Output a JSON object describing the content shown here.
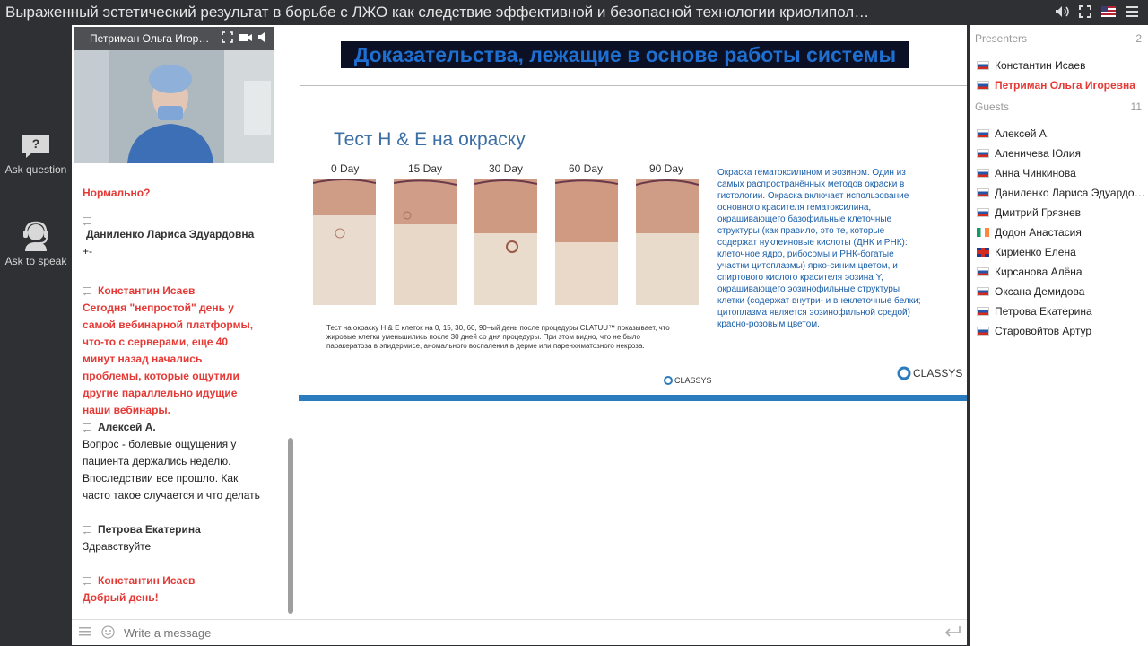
{
  "window": {
    "title": "Выраженный эстетический результат в борьбе с ЛЖО как следствие эффективной и безопасной технологии криолипол…"
  },
  "rail": {
    "ask_question": "Ask question",
    "ask_to_speak": "Ask to speak"
  },
  "video": {
    "presenter_name": "Петриман Ольга Игор…"
  },
  "chat": {
    "messages": [
      {
        "author": "",
        "text": "Нормально?",
        "red": true
      },
      {
        "author": "Даниленко Лариса Эдуардовна",
        "text": "+-",
        "red": false
      },
      {
        "author": "Константин Исаев",
        "text": "Сегодня \"непростой\" день у самой вебинарной платформы, что-то с серверами, еще 40 минут назад начались проблемы, которые ощутили другие параллельно идущие наши вебинары.",
        "red": true
      },
      {
        "author": "Алексей А.",
        "text": "Вопрос - болевые ощущения у пациента держались неделю. Впоследствии все прошло. Как часто такое случается и что делать",
        "red": false
      },
      {
        "author": "Петрова Екатерина",
        "text": "Здравствуйте",
        "red": false
      },
      {
        "author": "Константин Исаев",
        "text": "Добрый день!",
        "red": true
      }
    ]
  },
  "slide": {
    "title": "Доказательства, лежащие в основе работы системы",
    "subtitle": "Тест H & E на окраску",
    "days": [
      "0 Day",
      "15 Day",
      "30 Day",
      "60 Day",
      "90 Day"
    ],
    "caption": "Тест на окраску H & E клеток на 0, 15, 30, 60, 90–ый день после процедуры CLATUU™ показывает, что жировые клетки уменьшились после 30 дней со дня процедуры. При этом видно, что не было паракератоза в эпидермисе, аномального воспаления в дерме или паренхиматозного некроза.",
    "description": "Окраска гематоксилином и эозином. Один из самых распространённых методов окраски в гистологии. Окраска включает использование основного красителя гематоксилина, окрашивающего базофильные клеточные структуры (как правило, это те, которые содержат нуклеиновые кислоты (ДНК и РНК): клеточное ядро, рибосомы и РНК-богатые участки цитоплазмы) ярко-синим цветом, и спиртового кислого красителя эозина Y, окрашивающего эозинофильные структуры клетки (содержат внутри- и внеклеточные белки; цитоплазма является эозинофильной средой) красно-розовым цветом.",
    "logo_small": "CLASSYS",
    "logo_large": "CLASSYS"
  },
  "composer": {
    "placeholder": "Write a message"
  },
  "participants": {
    "presenters_label": "Presenters",
    "presenters_count": "2",
    "presenters": [
      {
        "name": "Константин Исаев",
        "flag": "ru",
        "red": false
      },
      {
        "name": "Петриман Ольга Игоревна",
        "flag": "ru",
        "red": true
      }
    ],
    "guests_label": "Guests",
    "guests_count": "11",
    "guests": [
      {
        "name": "Алексей А.",
        "flag": "ru"
      },
      {
        "name": "Аленичева Юлия",
        "flag": "ru"
      },
      {
        "name": "Анна Чинкинова",
        "flag": "ru"
      },
      {
        "name": "Даниленко Лариса Эдуардо…",
        "flag": "ru"
      },
      {
        "name": "Дмитрий Грязнев",
        "flag": "ru"
      },
      {
        "name": "Додон Анастасия",
        "flag": "ie"
      },
      {
        "name": "Кириенко Елена",
        "flag": "gb"
      },
      {
        "name": "Кирсанова Алёна",
        "flag": "ru"
      },
      {
        "name": "Оксана Демидова",
        "flag": "ru"
      },
      {
        "name": "Петрова Екатерина",
        "flag": "ru"
      },
      {
        "name": "Старовойтов Артур",
        "flag": "ru"
      }
    ]
  }
}
